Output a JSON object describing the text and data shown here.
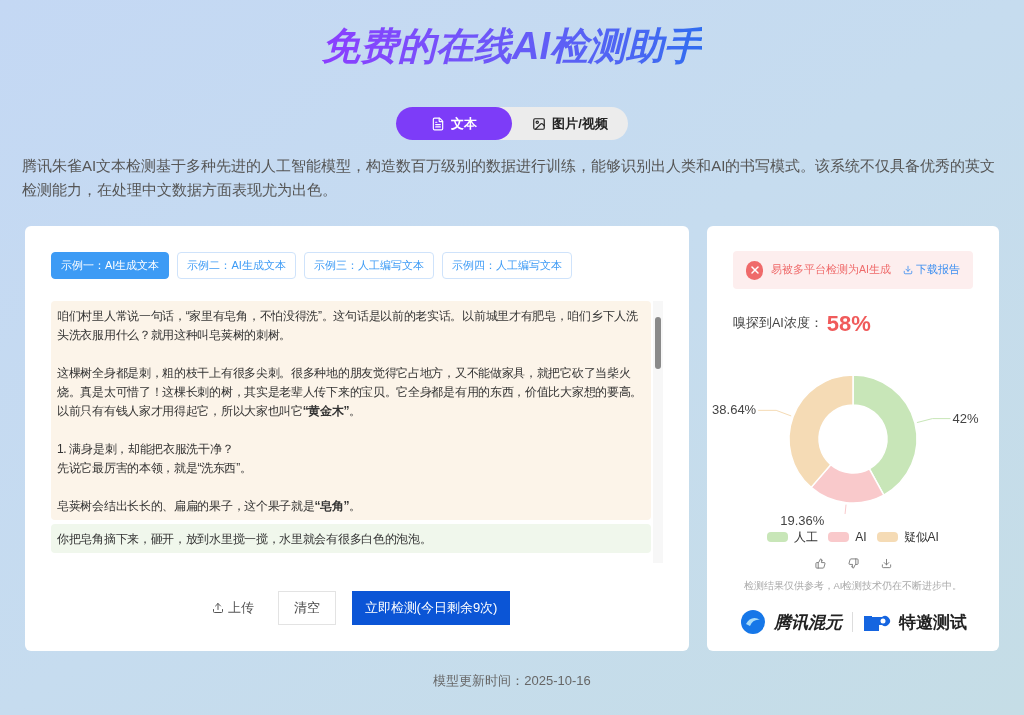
{
  "title": "免费的在线AI检测助手",
  "mode_tabs": [
    {
      "label": "文本",
      "selected": true
    },
    {
      "label": "图片/视频",
      "selected": false
    }
  ],
  "description": "腾讯朱雀AI文本检测基于多种先进的人工智能模型，构造数百万级别的数据进行训练，能够识别出人类和AI的书写模式。该系统不仅具备优秀的英文检测能力，在处理中文数据方面表现尤为出色。",
  "examples": [
    {
      "label": "示例一：AI生成文本",
      "selected": true
    },
    {
      "label": "示例二：AI生成文本",
      "selected": false
    },
    {
      "label": "示例三：人工编写文本",
      "selected": false
    },
    {
      "label": "示例四：人工编写文本",
      "selected": false
    }
  ],
  "segments": [
    {
      "kind": "suspect",
      "paragraphs": [
        [
          "咱们村里人常说一句话，“家里有皂角，不怕没得洗”。这句话是以前的老实话。以前城里才有肥皂，咱们乡下人洗头洗衣服用什么？就用这种叫皂荚树的刺树。"
        ],
        [
          "这棵树全身都是刺，粗的枝干上有很多尖刺。很多种地的朋友觉得它占地方，又不能做家具，就把它砍了当柴火烧。真是太可惜了！这棵长刺的树，其实是老辈人传下来的宝贝。它全身都是有用的东西，价值比大家想的要高。以前只有有钱人家才用得起它，所以大家也叫它**“黄金木”**。"
        ],
        [
          "1. 满身是刺，却能把衣服洗干净？",
          "先说它最厉害的本领，就是“洗东西”。"
        ],
        [
          "皂荚树会结出长长的、扁扁的果子，这个果子就是**“皂角”**。"
        ]
      ]
    },
    {
      "kind": "human",
      "paragraphs": [
        [
          "你把皂角摘下来，砸开，放到水里搅一搅，水里就会有很多白色的泡泡。"
        ]
      ]
    }
  ],
  "actions": {
    "upload": "上传",
    "clear": "清空",
    "detect": "立即检测(今日剩余9次)"
  },
  "result": {
    "alert": "易被多平台检测为AI生成",
    "download": "下载报告",
    "ratio_label": "嗅探到AI浓度：",
    "ratio_value": "58%",
    "chart_data": {
      "type": "donut",
      "categories": [
        "人工",
        "AI",
        "疑似AI"
      ],
      "values": [
        42,
        19.36,
        38.64
      ],
      "value_labels": [
        "42%",
        "19.36%",
        "38.64%"
      ]
    },
    "legend": [
      {
        "color": "#c8e6b8"
      },
      {
        "color": "#f9c9cb"
      },
      {
        "color": "#f5dbb5"
      }
    ],
    "note": "检测结果仅供参考，AI检测技术仍在不断进步中。",
    "logos": [
      "腾讯混元",
      "特邀测试"
    ]
  },
  "footer": "模型更新时间：2025-10-16"
}
